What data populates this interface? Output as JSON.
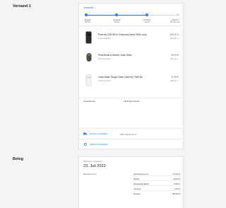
{
  "sections": {
    "shipment_title": "Versand 1",
    "receipt_title": "Beleg"
  },
  "shipment": {
    "header_label": "Versandt",
    "timeline": [
      {
        "label": "Bestellt",
        "date": "Juli 23",
        "status": "done"
      },
      {
        "label": "Versandt",
        "date": "Juli 24",
        "status": "done"
      },
      {
        "label": "Versandt",
        "date": "Juli 25",
        "status": "done"
      },
      {
        "label": "Geliefert",
        "date": "26.-28. Juli",
        "status": "pending"
      }
    ],
    "products": [
      {
        "name": "Pixel 6a 128 GB in Charcoal (ohne SIM-Lock)",
        "variant": "Sommerarbeit",
        "price": "449,00 €",
        "qty": "Menge: 1"
      },
      {
        "name": "Pixel Buds A-Series, Dark Olive",
        "variant": "Sommerarbeit",
        "price": "99,00 €",
        "qty": "Menge: 1"
      },
      {
        "name": "Case-Mate Tough Clear Case für Pixel 6a",
        "variant": "Sommerarbeit",
        "price": "21,99 €",
        "qty": "Menge: 1"
      }
    ],
    "shipping_address_label": "Lieferadresse",
    "payment_label": "Zahlungsmethode",
    "track_label": "Lieferung verfolgen",
    "carrier": "DHL Parcel Conn.",
    "return_label": "Artikel zurückgeben",
    "colors": {
      "accent": "#1a73e8",
      "pending": "#dadce0"
    }
  },
  "receipt": {
    "caption": "Bestellung aufgegeben",
    "date": "23. Juli 2022",
    "order_number_label": "Bestellnummer",
    "totals": [
      {
        "label": "Zwischensumme",
        "value": "770,99 €"
      },
      {
        "label": "Rabatt",
        "value": "-99,00 €"
      },
      {
        "label": "Geschätzte MwSt.",
        "value": "76,80 €"
      },
      {
        "label": "Versand",
        "value": "0,00 €"
      },
      {
        "label": "Gesamt",
        "value": "483,99 €"
      }
    ]
  }
}
